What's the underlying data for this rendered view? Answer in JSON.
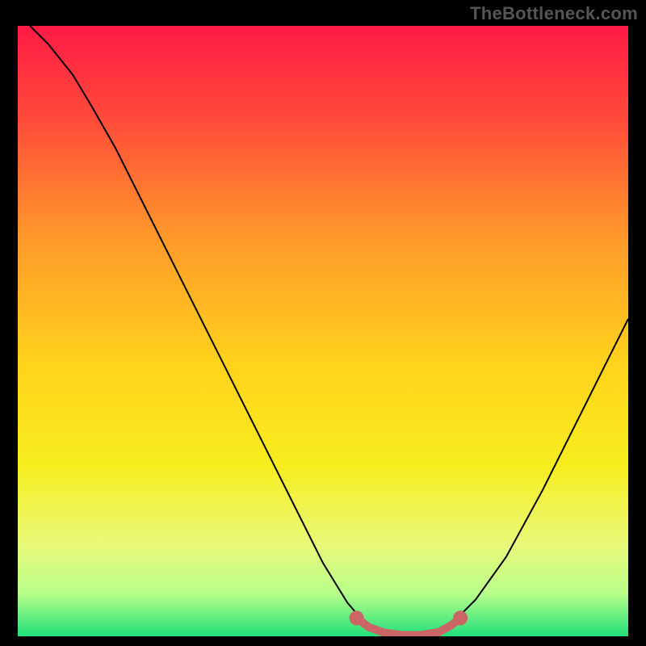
{
  "watermark": "TheBottleneck.com",
  "chart_data": {
    "type": "line",
    "title": "",
    "xlabel": "",
    "ylabel": "",
    "xlim": [
      0,
      100
    ],
    "ylim": [
      0,
      100
    ],
    "grid": false,
    "legend": false,
    "background_gradient": {
      "stops": [
        {
          "offset": 0.0,
          "color": "#ff1a44"
        },
        {
          "offset": 0.15,
          "color": "#ff4a3a"
        },
        {
          "offset": 0.35,
          "color": "#ff9a2a"
        },
        {
          "offset": 0.55,
          "color": "#ffd21c"
        },
        {
          "offset": 0.72,
          "color": "#f7ee1e"
        },
        {
          "offset": 0.85,
          "color": "#e9f97a"
        },
        {
          "offset": 0.93,
          "color": "#b8ff8a"
        },
        {
          "offset": 1.0,
          "color": "#21e07a"
        }
      ]
    },
    "series": [
      {
        "name": "bottleneck-curve",
        "stroke": "#000000",
        "stroke_width": 2,
        "points": [
          {
            "x": 2.0,
            "y": 100.0
          },
          {
            "x": 5.0,
            "y": 97.0
          },
          {
            "x": 9.0,
            "y": 92.0
          },
          {
            "x": 12.0,
            "y": 87.0
          },
          {
            "x": 16.0,
            "y": 80.0
          },
          {
            "x": 21.0,
            "y": 70.0
          },
          {
            "x": 27.0,
            "y": 58.0
          },
          {
            "x": 33.0,
            "y": 46.0
          },
          {
            "x": 39.0,
            "y": 34.0
          },
          {
            "x": 45.0,
            "y": 22.0
          },
          {
            "x": 50.0,
            "y": 12.0
          },
          {
            "x": 54.0,
            "y": 5.5
          },
          {
            "x": 57.0,
            "y": 2.0
          },
          {
            "x": 60.0,
            "y": 0.5
          },
          {
            "x": 64.0,
            "y": 0.0
          },
          {
            "x": 68.0,
            "y": 0.5
          },
          {
            "x": 71.0,
            "y": 2.0
          },
          {
            "x": 75.0,
            "y": 6.0
          },
          {
            "x": 80.0,
            "y": 13.0
          },
          {
            "x": 86.0,
            "y": 24.0
          },
          {
            "x": 92.0,
            "y": 36.0
          },
          {
            "x": 97.0,
            "y": 46.0
          },
          {
            "x": 100.0,
            "y": 52.0
          }
        ]
      },
      {
        "name": "optimal-band",
        "stroke": "#cc6666",
        "stroke_width": 10,
        "points": [
          {
            "x": 55.5,
            "y": 3.0
          },
          {
            "x": 57.5,
            "y": 1.5
          },
          {
            "x": 60.0,
            "y": 0.6
          },
          {
            "x": 63.0,
            "y": 0.2
          },
          {
            "x": 66.0,
            "y": 0.2
          },
          {
            "x": 69.0,
            "y": 0.7
          },
          {
            "x": 71.0,
            "y": 1.8
          },
          {
            "x": 72.5,
            "y": 3.0
          }
        ],
        "end_caps": [
          {
            "x": 55.5,
            "y": 3.0,
            "r": 1.2
          },
          {
            "x": 72.5,
            "y": 3.0,
            "r": 1.2
          }
        ]
      }
    ]
  }
}
